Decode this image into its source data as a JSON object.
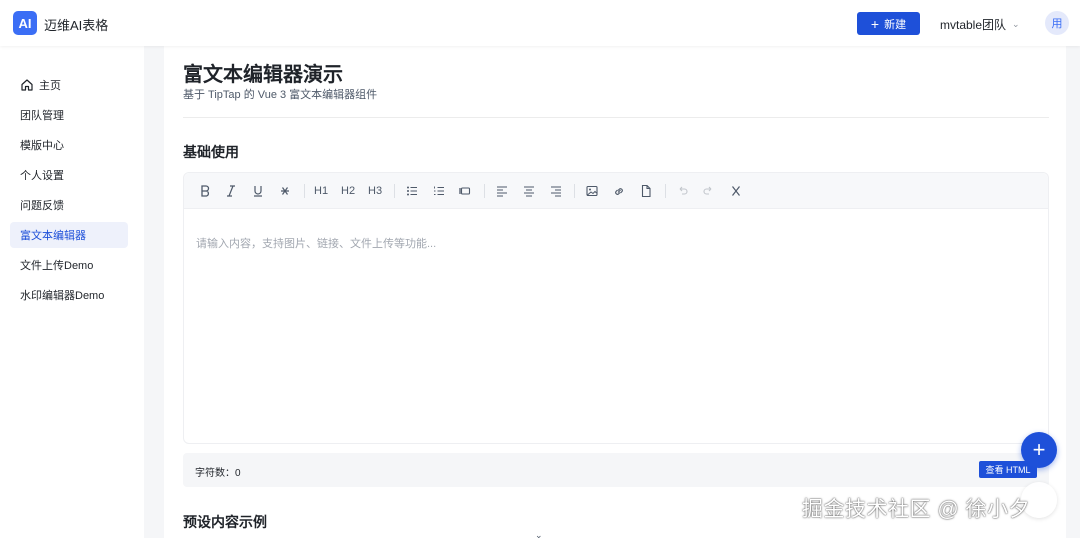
{
  "header": {
    "logo_text": "AI",
    "app_title": "迈维AI表格",
    "new_button": "新建",
    "new_icon": "plus-icon",
    "team_name": "mvtable团队",
    "avatar_text": "用",
    "accent_color": "#1e50d9"
  },
  "sidebar": {
    "items": [
      {
        "label": "主页",
        "icon": "home-icon"
      },
      {
        "label": "团队管理"
      },
      {
        "label": "模版中心"
      },
      {
        "label": "个人设置"
      },
      {
        "label": "问题反馈"
      },
      {
        "label": "富文本编辑器",
        "active": true
      },
      {
        "label": "文件上传Demo"
      },
      {
        "label": "水印编辑器Demo"
      }
    ]
  },
  "main": {
    "title": "富文本编辑器演示",
    "subtitle": "基于 TipTap 的 Vue 3 富文本编辑器组件",
    "section1_title": "基础使用",
    "section2_title": "预设内容示例",
    "editor": {
      "toolbar": {
        "h1": "H1",
        "h2": "H2",
        "h3": "H3",
        "icons": [
          "bold-icon",
          "italic-icon",
          "underline-icon",
          "strikethrough-icon",
          "bullet-list-icon",
          "ordered-list-icon",
          "blockquote-icon",
          "align-left-icon",
          "align-center-icon",
          "align-right-icon",
          "image-icon",
          "link-icon",
          "file-icon",
          "undo-icon",
          "redo-icon",
          "clear-format-icon"
        ]
      },
      "placeholder": "请输入内容，支持图片、链接、文件上传等功能..."
    },
    "status": {
      "word_count": "字符数：0",
      "view_html": "查看 HTML"
    }
  },
  "fab_label": "+",
  "watermark": "掘金技术社区 @ 徐小夕"
}
